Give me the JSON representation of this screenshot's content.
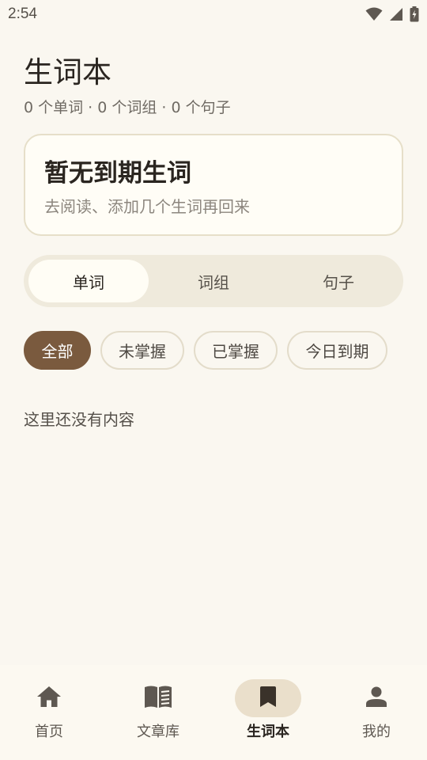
{
  "status_bar": {
    "time": "2:54"
  },
  "header": {
    "title": "生词本",
    "subtitle": "0 个单词 · 0 个词组 · 0 个句子"
  },
  "due_card": {
    "title": "暂无到期生词",
    "description": "去阅读、添加几个生词再回来"
  },
  "segments": [
    {
      "label": "单词",
      "active": true
    },
    {
      "label": "词组",
      "active": false
    },
    {
      "label": "句子",
      "active": false
    }
  ],
  "filters": [
    {
      "label": "全部",
      "active": true
    },
    {
      "label": "未掌握",
      "active": false
    },
    {
      "label": "已掌握",
      "active": false
    },
    {
      "label": "今日到期",
      "active": false
    }
  ],
  "empty_state": {
    "text": "这里还没有内容"
  },
  "bottom_nav": [
    {
      "label": "首页",
      "icon": "home-icon",
      "active": false
    },
    {
      "label": "文章库",
      "icon": "book-icon",
      "active": false
    },
    {
      "label": "生词本",
      "icon": "bookmark-icon",
      "active": true
    },
    {
      "label": "我的",
      "icon": "person-icon",
      "active": false
    }
  ],
  "colors": {
    "background": "#FAF7F0",
    "accent": "#7A5A3E",
    "nav_active_bg": "#EADFCB"
  }
}
